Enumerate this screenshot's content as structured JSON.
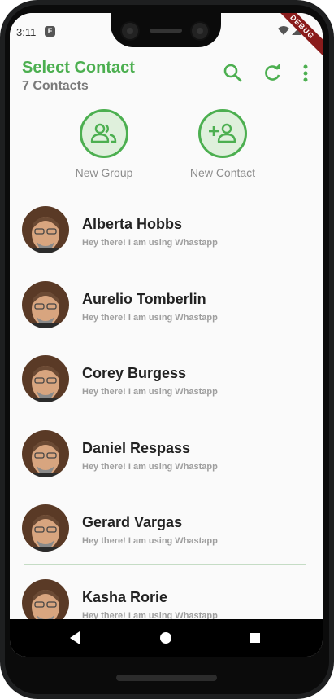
{
  "status_bar": {
    "time": "3:11",
    "app_badge": "F",
    "debug_label": "DEBUG"
  },
  "app_bar": {
    "title": "Select Contact",
    "subtitle": "7 Contacts",
    "actions": [
      "search-icon",
      "refresh-icon",
      "more-vert-icon"
    ]
  },
  "quick_actions": {
    "new_group": "New Group",
    "new_contact": "New Contact"
  },
  "contacts": [
    {
      "name": "Alberta Hobbs",
      "about": "Hey there! I am using Whastapp"
    },
    {
      "name": "Aurelio Tomberlin",
      "about": "Hey there! I am using Whastapp"
    },
    {
      "name": "Corey Burgess",
      "about": "Hey there! I am using Whastapp"
    },
    {
      "name": "Daniel Respass",
      "about": "Hey there! I am using Whastapp"
    },
    {
      "name": "Gerard Vargas",
      "about": "Hey there! I am using Whastapp"
    },
    {
      "name": "Kasha Rorie",
      "about": "Hey there! I am using Whastapp"
    }
  ],
  "colors": {
    "accent": "#4caf50",
    "subtitle": "#7a7a7a",
    "divider": "#c5dcc5"
  },
  "nav_bar": [
    "back-icon",
    "home-icon",
    "recents-icon"
  ]
}
